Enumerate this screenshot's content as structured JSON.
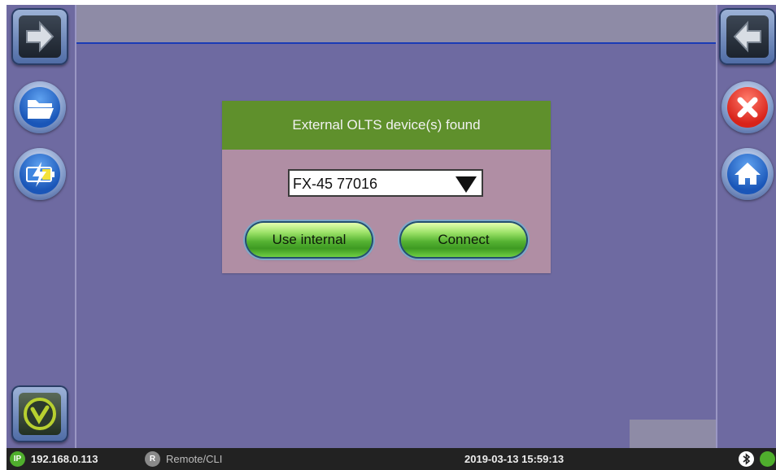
{
  "dialog": {
    "title": "External OLTS device(s) found",
    "device_select": {
      "selected": "FX-45 77016"
    },
    "buttons": {
      "use_internal": "Use internal",
      "connect": "Connect"
    }
  },
  "left_sidebar": {
    "items": [
      {
        "icon": "arrow-right-icon"
      },
      {
        "icon": "folder-open-icon"
      },
      {
        "icon": "battery-charge-icon"
      },
      {
        "icon": "logo-v-icon"
      }
    ]
  },
  "right_sidebar": {
    "items": [
      {
        "icon": "arrow-left-icon"
      },
      {
        "icon": "close-icon"
      },
      {
        "icon": "home-icon"
      }
    ]
  },
  "status_bar": {
    "ip_badge": "IP",
    "ip_address": "192.168.0.113",
    "remote_badge": "R",
    "remote_label": "Remote/CLI",
    "datetime": "2019-03-13  15:59:13"
  },
  "colors": {
    "background": "#6e6aa1",
    "dialog_title_bg": "#5f902c",
    "dialog_body_bg": "#b08ea4",
    "button_green": "#55b232",
    "accent_line": "#1a3bb5"
  }
}
